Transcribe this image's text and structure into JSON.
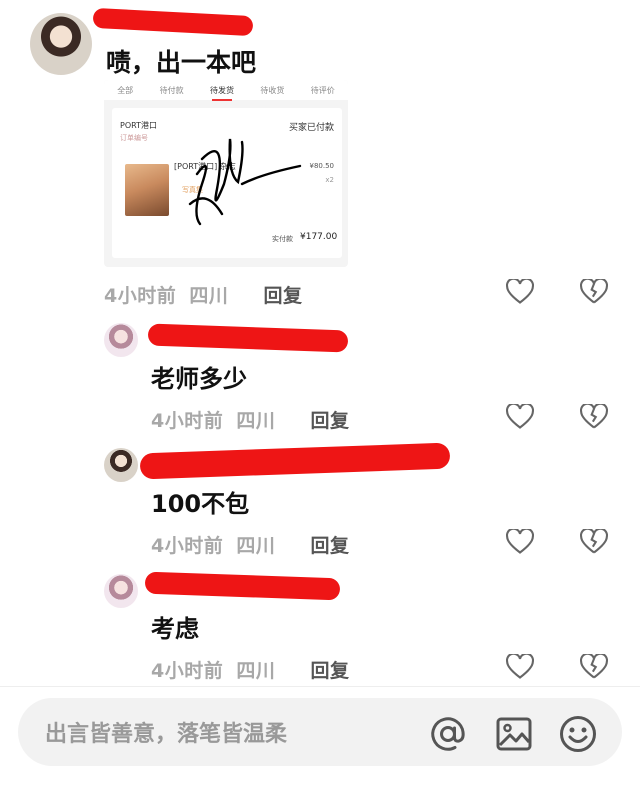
{
  "post": {
    "text": "啧，出一本吧",
    "order_screenshot": {
      "tabs": [
        "全部",
        "待付款",
        "待发货",
        "待收货",
        "待评价"
      ],
      "active_tab_index": 2,
      "shop_name": "PORT港口",
      "shop_sub": "订单编号",
      "status": "买家已付款",
      "product_title": "[PORT港口] 杂志",
      "product_sub": "写真集",
      "price": "¥80.50",
      "qty": "x2",
      "paid_label": "实付款",
      "paid_amount": "¥177.00"
    },
    "time": "4小时前",
    "location": "四川",
    "reply_label": "回复"
  },
  "replies": [
    {
      "text": "老师多少",
      "time": "4小时前",
      "location": "四川",
      "reply_label": "回复"
    },
    {
      "text": "100不包",
      "time": "4小时前",
      "location": "四川",
      "reply_label": "回复"
    },
    {
      "text": "考虑",
      "time": "4小时前",
      "location": "四川",
      "reply_label": "回复"
    }
  ],
  "input": {
    "placeholder": "出言皆善意，落笔皆温柔"
  },
  "colors": {
    "redaction": "#ee1515",
    "meta_text": "#a8a8a8",
    "input_bg": "#f2f2f2"
  },
  "icons": [
    "heart-icon",
    "broken-heart-icon",
    "at-icon",
    "image-icon",
    "emoji-icon"
  ]
}
